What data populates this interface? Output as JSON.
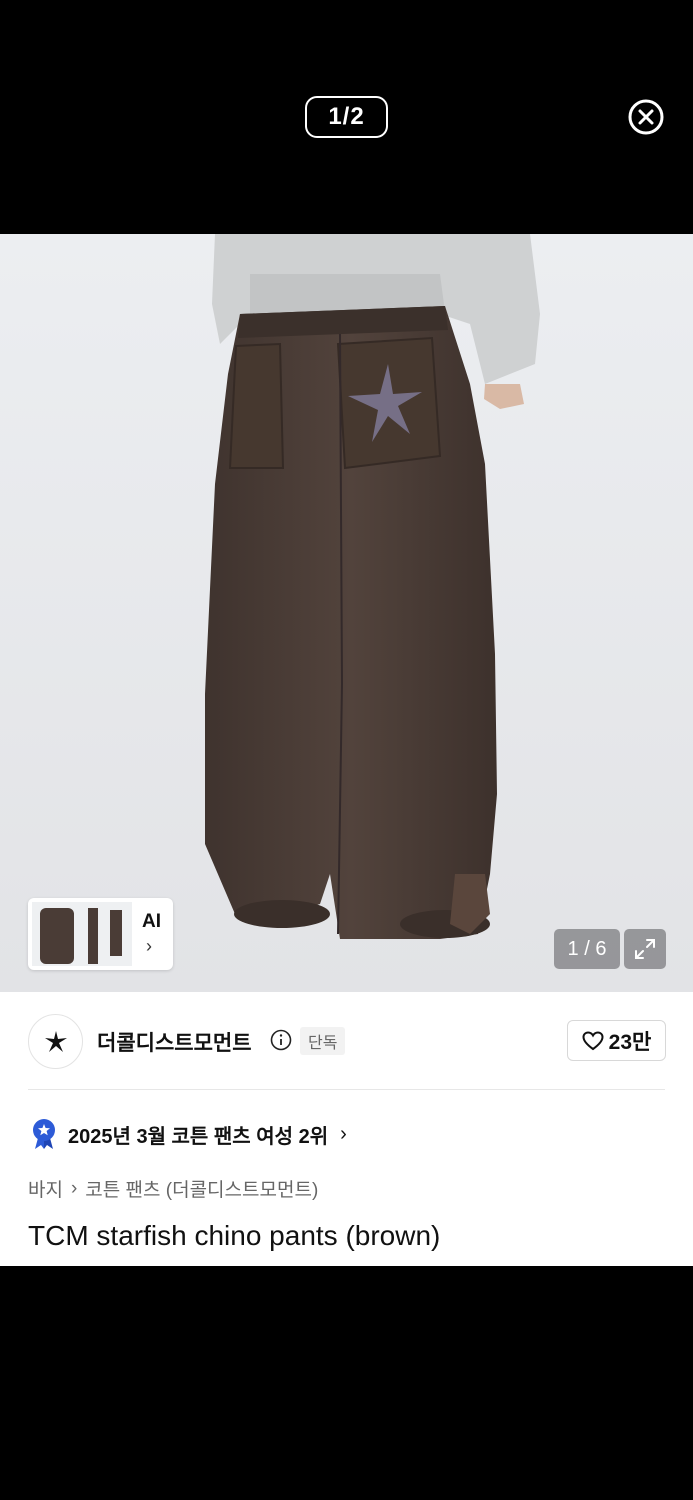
{
  "viewer": {
    "page_indicator": "1/2",
    "close_icon": "close-circle-icon"
  },
  "gallery": {
    "image_description_icon": "product-photo",
    "ai_label": "AI",
    "ai_chevron": "›",
    "counter": "1 / 6",
    "expand_icon": "expand-icon"
  },
  "brand": {
    "name": "더콜디스트모먼트",
    "badge": "단독",
    "info_icon": "info-icon"
  },
  "like": {
    "count": "23만",
    "icon": "heart-icon"
  },
  "ranking": {
    "text": "2025년 3월 코튼 팬츠 여성 2위",
    "chevron": "›",
    "icon": "ribbon-badge-icon"
  },
  "breadcrumb": {
    "category": "바지",
    "separator": "›",
    "subcategory": "코튼 팬츠 (더콜디스트모먼트)"
  },
  "product": {
    "title": "TCM starfish chino pants (brown)"
  },
  "colors": {
    "background": "#000000",
    "pants": "#4a3c36",
    "badge_blue": "#2d5bd7"
  }
}
